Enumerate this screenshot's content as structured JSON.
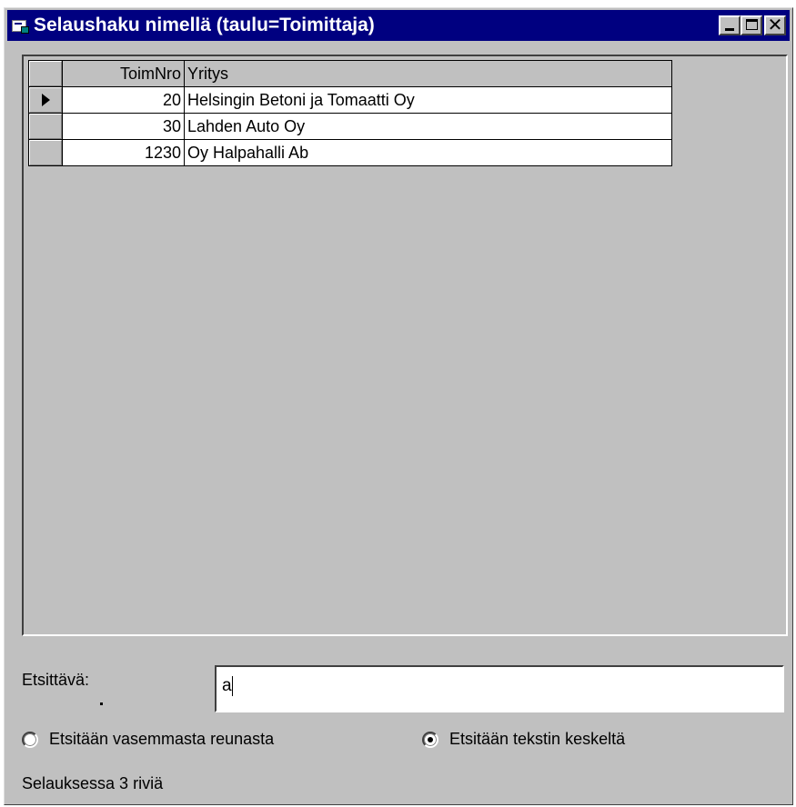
{
  "window": {
    "title": "Selaushaku nimellä (taulu=Toimittaja)"
  },
  "grid": {
    "columns": [
      "ToimNro",
      "Yritys"
    ],
    "rows": [
      {
        "ToimNro": "20",
        "Yritys": "Helsingin Betoni ja Tomaatti Oy",
        "current": true
      },
      {
        "ToimNro": "30",
        "Yritys": "Lahden Auto Oy",
        "current": false
      },
      {
        "ToimNro": "1230",
        "Yritys": "Oy Halpahalli Ab",
        "current": false
      }
    ]
  },
  "search": {
    "label": "Etsittävä:",
    "value": "a"
  },
  "options": {
    "left_edge": {
      "label": "Etsitään vasemmasta reunasta",
      "checked": false
    },
    "middle": {
      "label": "Etsitään tekstin keskeltä",
      "checked": true
    }
  },
  "status": {
    "text": "Selauksessa 3 riviä"
  },
  "colors": {
    "titlebar": "#000080",
    "face": "#c0c0c0"
  }
}
